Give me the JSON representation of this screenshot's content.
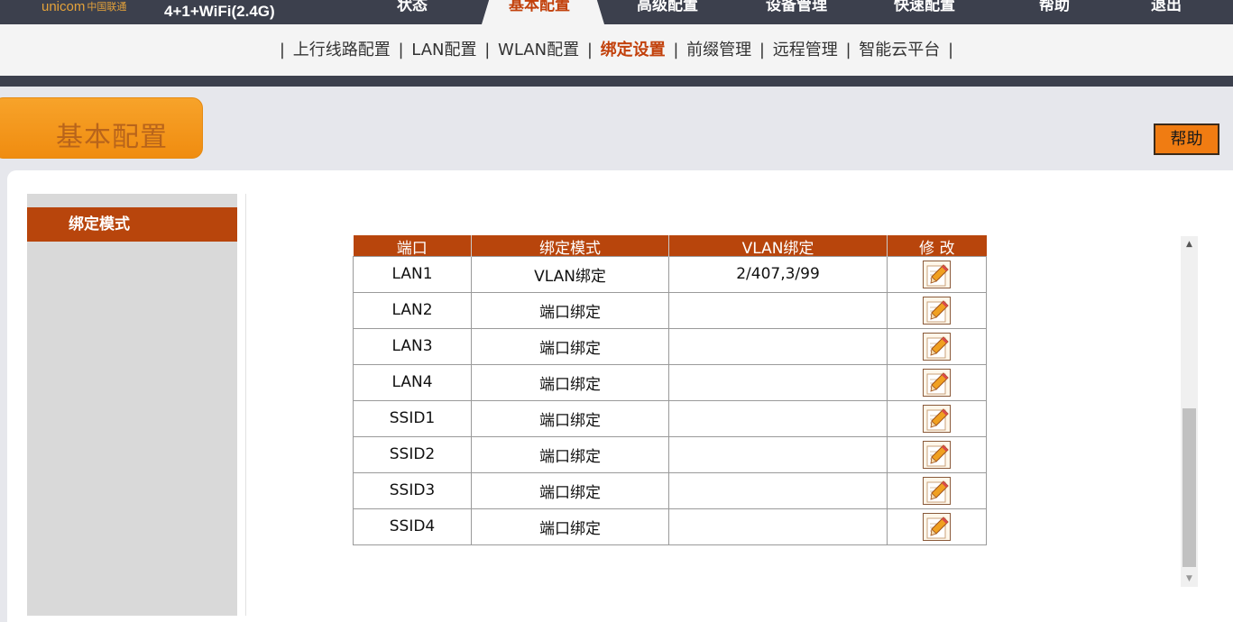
{
  "brand": {
    "logo_text": "unicom",
    "logo_cn": "中国联通",
    "model": "4+1+WiFi(2.4G)"
  },
  "main_nav": [
    {
      "label": "状态",
      "active": false
    },
    {
      "label": "基本配置",
      "active": true
    },
    {
      "label": "高级配置",
      "active": false
    },
    {
      "label": "设备管理",
      "active": false
    },
    {
      "label": "快速配置",
      "active": false
    },
    {
      "label": "帮助",
      "active": false
    },
    {
      "label": "退出",
      "active": false
    }
  ],
  "sub_nav": [
    {
      "label": "上行线路配置",
      "active": false
    },
    {
      "label": "LAN配置",
      "active": false
    },
    {
      "label": "WLAN配置",
      "active": false
    },
    {
      "label": "绑定设置",
      "active": true
    },
    {
      "label": "前缀管理",
      "active": false
    },
    {
      "label": "远程管理",
      "active": false
    },
    {
      "label": "智能云平台",
      "active": false
    }
  ],
  "separator": "|",
  "section_title": "基本配置",
  "help_button": "帮助",
  "sidebar": {
    "active_item": "绑定模式"
  },
  "table": {
    "headers": [
      "端口",
      "绑定模式",
      "VLAN绑定",
      "修 改"
    ],
    "rows": [
      {
        "port": "LAN1",
        "mode": "VLAN绑定",
        "vlan": "2/407,3/99"
      },
      {
        "port": "LAN2",
        "mode": "端口绑定",
        "vlan": ""
      },
      {
        "port": "LAN3",
        "mode": "端口绑定",
        "vlan": ""
      },
      {
        "port": "LAN4",
        "mode": "端口绑定",
        "vlan": ""
      },
      {
        "port": "SSID1",
        "mode": "端口绑定",
        "vlan": ""
      },
      {
        "port": "SSID2",
        "mode": "端口绑定",
        "vlan": ""
      },
      {
        "port": "SSID3",
        "mode": "端口绑定",
        "vlan": ""
      },
      {
        "port": "SSID4",
        "mode": "端口绑定",
        "vlan": ""
      }
    ],
    "edit_icon": "pencil-edit-icon"
  },
  "scrollbar": {
    "up": "▲",
    "down": "▼"
  },
  "colors": {
    "accent": "#b8450c",
    "topbar": "#3c404d",
    "orange": "#f08c10",
    "active_text": "#c2410c"
  }
}
